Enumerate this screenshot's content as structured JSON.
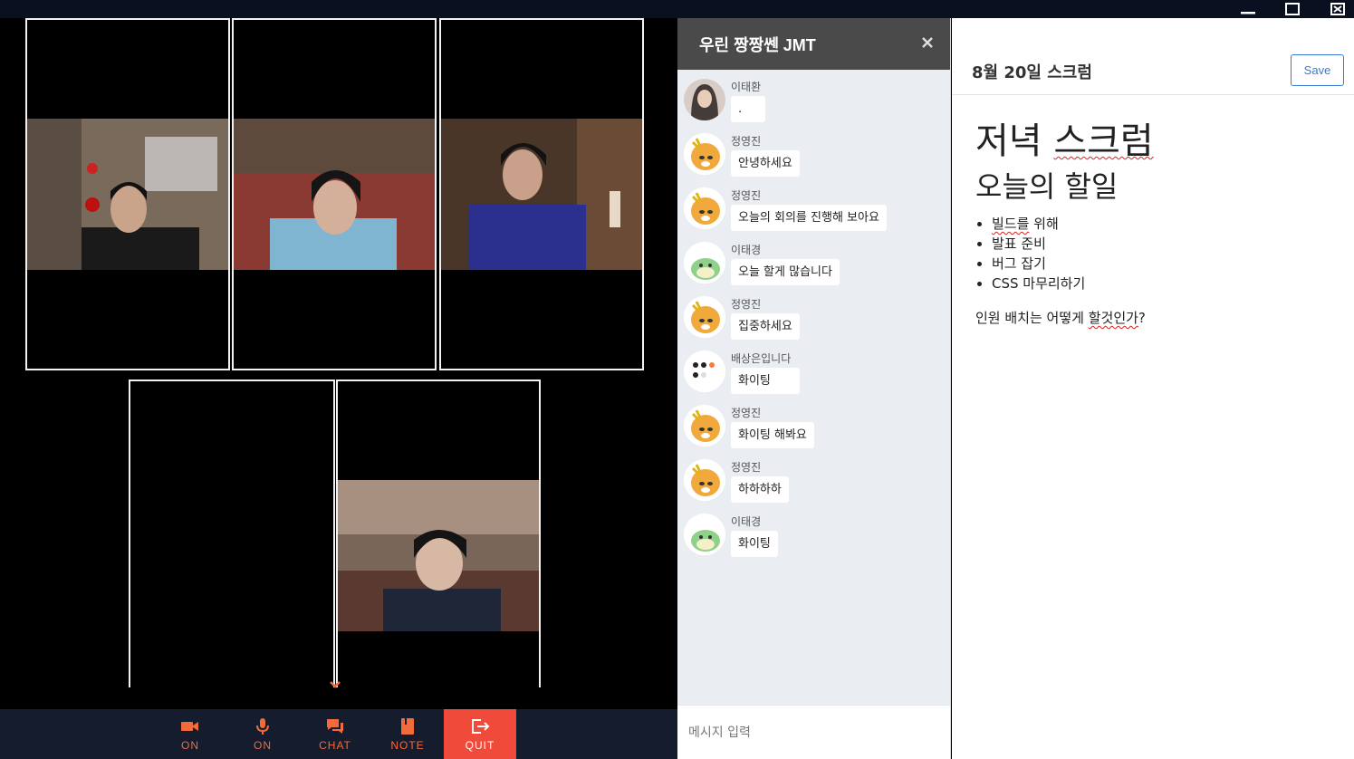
{
  "window": {
    "controls": [
      {
        "name": "minimize-icon"
      },
      {
        "name": "maximize-icon"
      },
      {
        "name": "close-window-icon"
      }
    ]
  },
  "video": {
    "expand_icon": "chevron-down-icon"
  },
  "controls": [
    {
      "id": "video",
      "label": "ON",
      "icon": "video-camera-icon"
    },
    {
      "id": "mic",
      "label": "ON",
      "icon": "microphone-icon"
    },
    {
      "id": "chat",
      "label": "CHAT",
      "icon": "chat-icon"
    },
    {
      "id": "note",
      "label": "NOTE",
      "icon": "notebook-icon"
    },
    {
      "id": "quit",
      "label": "QUIT",
      "icon": "exit-icon"
    }
  ],
  "colors": {
    "accent": "#f26b3a",
    "quit": "#ef4a3a",
    "control_bar": "#141c2e",
    "chat_header": "#4a4a4a",
    "save_button": "#3a7bd5"
  },
  "chat": {
    "title": "우린 짱짱쎈 JMT",
    "input_placeholder": "메시지 입력",
    "messages": [
      {
        "sender": "이태환",
        "text": ".",
        "avatar": "photo-avatar"
      },
      {
        "sender": "정영진",
        "text": "안녕하세요",
        "avatar": "lion-avatar"
      },
      {
        "sender": "정영진",
        "text": "오늘의 회의를 진행해 보아요",
        "avatar": "lion-avatar"
      },
      {
        "sender": "이태경",
        "text": "오늘 할게 많습니다",
        "avatar": "dino-avatar"
      },
      {
        "sender": "정영진",
        "text": "집중하세요",
        "avatar": "lion-avatar"
      },
      {
        "sender": "배상은입니다",
        "text": "화이팅",
        "avatar": "dots-avatar"
      },
      {
        "sender": "정영진",
        "text": "화이팅 해봐요",
        "avatar": "lion-avatar"
      },
      {
        "sender": "정영진",
        "text": "하하하하",
        "avatar": "lion-avatar"
      },
      {
        "sender": "이태경",
        "text": "화이팅",
        "avatar": "dino-avatar"
      }
    ]
  },
  "note": {
    "title": "8월 20일 스크럼",
    "save_label": "Save",
    "heading1_a": "저녁 ",
    "heading1_b": "스크럼",
    "heading2": "오늘의 할일",
    "list": [
      {
        "a": "",
        "b": "빌드를",
        "c": " 위해"
      },
      {
        "a": "발표 준비",
        "b": "",
        "c": ""
      },
      {
        "a": "버그 잡기",
        "b": "",
        "c": ""
      },
      {
        "a": "CSS 마무리하기",
        "b": "",
        "c": ""
      }
    ],
    "para_a": "인원 배치는 어떻게 ",
    "para_b": "할것인가",
    "para_c": "?"
  }
}
